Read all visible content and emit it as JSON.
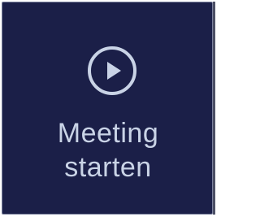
{
  "tile": {
    "line1": "Meeting",
    "line2": "starten",
    "icon": "play-circle-icon",
    "background_color": "#1b1f48",
    "foreground_color": "#c9d3e6"
  }
}
